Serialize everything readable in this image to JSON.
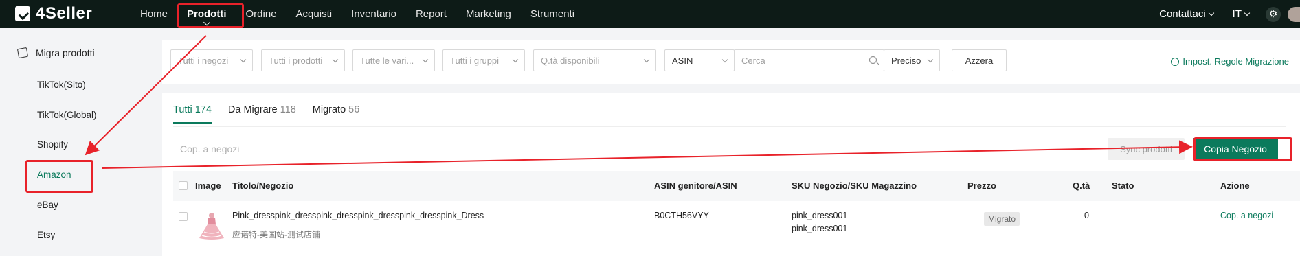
{
  "app": {
    "name": "4Seller"
  },
  "nav": {
    "items": [
      "Home",
      "Prodotti",
      "Ordine",
      "Acquisti",
      "Inventario",
      "Report",
      "Marketing",
      "Strumenti"
    ],
    "active": "Prodotti",
    "contacts": "Contattaci",
    "language": "IT"
  },
  "sidebar": {
    "header": "Migra prodotti",
    "items": [
      "TikTok(Sito)",
      "TikTok(Global)",
      "Shopify",
      "Amazon",
      "eBay",
      "Etsy"
    ],
    "active": "Amazon"
  },
  "filters": {
    "stores": "Tutti i negozi",
    "products": "Tutti i prodotti",
    "variants": "Tutte le vari...",
    "groups": "Tutti i gruppi",
    "qty": "Q.tà disponibili",
    "search_type": "ASIN",
    "search_placeholder": "Cerca",
    "match": "Preciso",
    "reset": "Azzera",
    "rules_link": "Impost. Regole Migrazione"
  },
  "tabs": [
    {
      "label": "Tutti",
      "count": "174"
    },
    {
      "label": "Da Migrare",
      "count": "118"
    },
    {
      "label": "Migrato",
      "count": "56"
    }
  ],
  "actions": {
    "copy_to_stores": "Cop. a negozi",
    "sync_products": "Sync prodotti",
    "copy_store": "Copia Negozio"
  },
  "table": {
    "headers": [
      "Image",
      "Titolo/Negozio",
      "ASIN genitore/ASIN",
      "SKU Negozio/SKU Magazzino",
      "Prezzo",
      "Q.tà",
      "Stato",
      "Azione"
    ],
    "rows": [
      {
        "title": "Pink_dresspink_dresspink_dresspink_dresspink_dresspink_Dress",
        "store": "应诺特-美国站-测试店铺",
        "asin": "B0CTH56VYY",
        "sku_store": "pink_dress001",
        "sku_warehouse": "pink_dress001",
        "price_1": "-",
        "price_2": "-",
        "qty": "0",
        "status": "Migrato",
        "action": "Cop. a negozi"
      }
    ]
  },
  "colors": {
    "accent": "#0b7a5c",
    "topbar": "#0d1b17",
    "annotation": "#e8222a"
  }
}
